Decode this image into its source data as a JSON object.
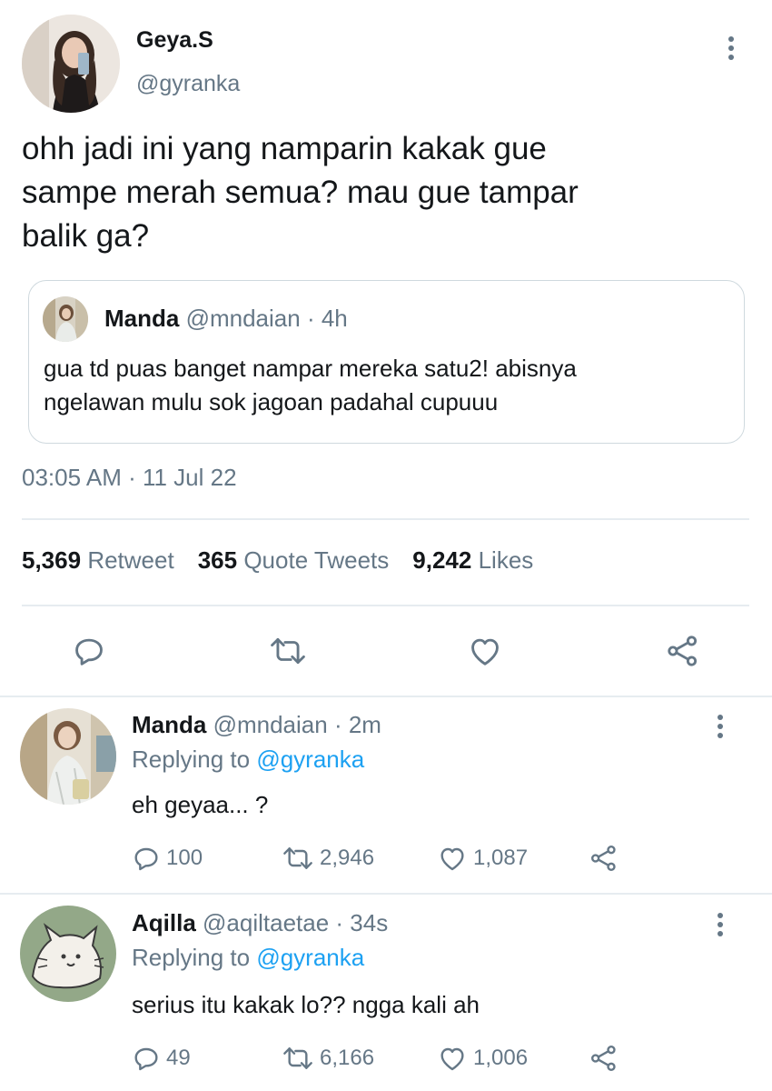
{
  "tweet": {
    "name": "Geya.S",
    "handle": "@gyranka",
    "text_lines": [
      "ohh jadi ini yang namparin kakak gue",
      "sampe merah semua? mau gue tampar",
      "balik ga?"
    ],
    "timestamp": "03:05 AM · 11 Jul 22",
    "quote": {
      "name": "Manda",
      "handle": "@mndaian",
      "separator": " · ",
      "time": "4h",
      "text_lines": [
        "gua td puas banget nampar mereka satu2! abisnya",
        "ngelawan mulu sok jagoan padahal cupuuu"
      ]
    },
    "stats": {
      "retweets_count": "5,369",
      "retweets_label": "Retweet",
      "quotes_count": "365",
      "quotes_label": "Quote Tweets",
      "likes_count": "9,242",
      "likes_label": "Likes"
    }
  },
  "replies": [
    {
      "name": "Manda",
      "handle": "@mndaian",
      "separator": " · ",
      "time": "2m",
      "replying_prefix": "Replying to ",
      "replying_to": "@gyranka",
      "text": "eh geyaa... ?",
      "reply_count": "100",
      "retweet_count": "2,946",
      "like_count": "1,087"
    },
    {
      "name": "Aqilla",
      "handle": "@aqiltaetae",
      "separator": " · ",
      "time": "34s",
      "replying_prefix": "Replying to ",
      "replying_to": "@gyranka",
      "text": "serius itu kakak lo?? ngga kali ah",
      "reply_count": "49",
      "retweet_count": "6,166",
      "like_count": "1,006"
    }
  ],
  "icons": {
    "reply": "reply-icon",
    "retweet": "retweet-icon",
    "like": "heart-icon",
    "share": "share-icon",
    "more": "more-vertical-icon"
  },
  "colors": {
    "text": "#14171a",
    "secondary": "#657786",
    "link": "#1da1f2",
    "divider": "#e6ecf0"
  }
}
